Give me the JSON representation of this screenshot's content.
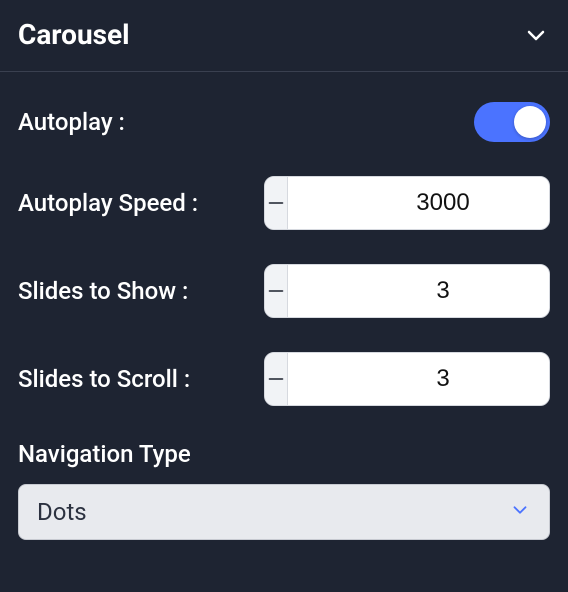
{
  "panel": {
    "title": "Carousel"
  },
  "fields": {
    "autoplay": {
      "label": "Autoplay :",
      "enabled": true
    },
    "autoplay_speed": {
      "label": "Autoplay Speed :",
      "value": "3000"
    },
    "slides_to_show": {
      "label": "Slides to Show :",
      "value": "3"
    },
    "slides_to_scroll": {
      "label": "Slides to Scroll :",
      "value": "3"
    },
    "navigation_type": {
      "label": "Navigation Type",
      "value": "Dots"
    }
  }
}
